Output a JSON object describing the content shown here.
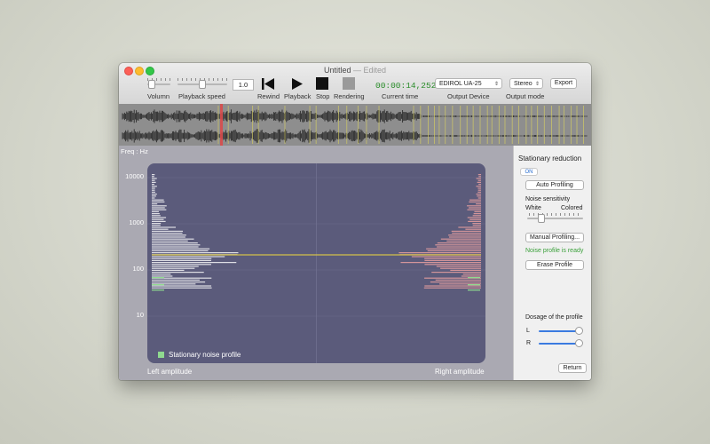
{
  "window": {
    "title": "Untitled",
    "edited_suffix": "— Edited"
  },
  "toolbar": {
    "volume_label": "Volumn",
    "speed_label": "Playback speed",
    "speed_value": "1.0",
    "rewind_label": "Rewind",
    "playback_label": "Playback",
    "stop_label": "Stop",
    "rendering_label": "Rendering",
    "current_time": "00:00:14,252",
    "current_time_label": "Current time",
    "output_device": "EDIROL UA-25",
    "output_device_label": "Output Device",
    "output_mode": "Stereo",
    "output_mode_label": "Output mode",
    "export_label": "Export",
    "volume_level": 0.2,
    "speed_level": 0.5
  },
  "main": {
    "freq_label": "Freq : Hz",
    "ticks": [
      "10000",
      "1000",
      "100",
      "10"
    ],
    "legend": "Stationary noise profile",
    "left_amp": "Left amplitude",
    "right_amp": "Right amplitude",
    "colors": {
      "left_bars": "#ffffff",
      "right_bars": "#e9a0a0",
      "profile_line": "#d4c04a",
      "legend_swatch": "#8fd98f"
    }
  },
  "side": {
    "title": "Stationary reduction",
    "on_label": "ON",
    "auto_profiling": "Auto Profiling",
    "noise_sensitivity": "Noise sensitivity",
    "white": "White",
    "colored": "Colored",
    "manual_profiling": "Manual Profiling...",
    "profile_ready": "Noise profile is ready",
    "erase_profile": "Erase Profile",
    "dosage": "Dosage of the profile",
    "l": "L",
    "r": "R",
    "return": "Return",
    "sensitivity_level": 0.25,
    "dosage_l": 1.0,
    "dosage_r": 1.0
  }
}
